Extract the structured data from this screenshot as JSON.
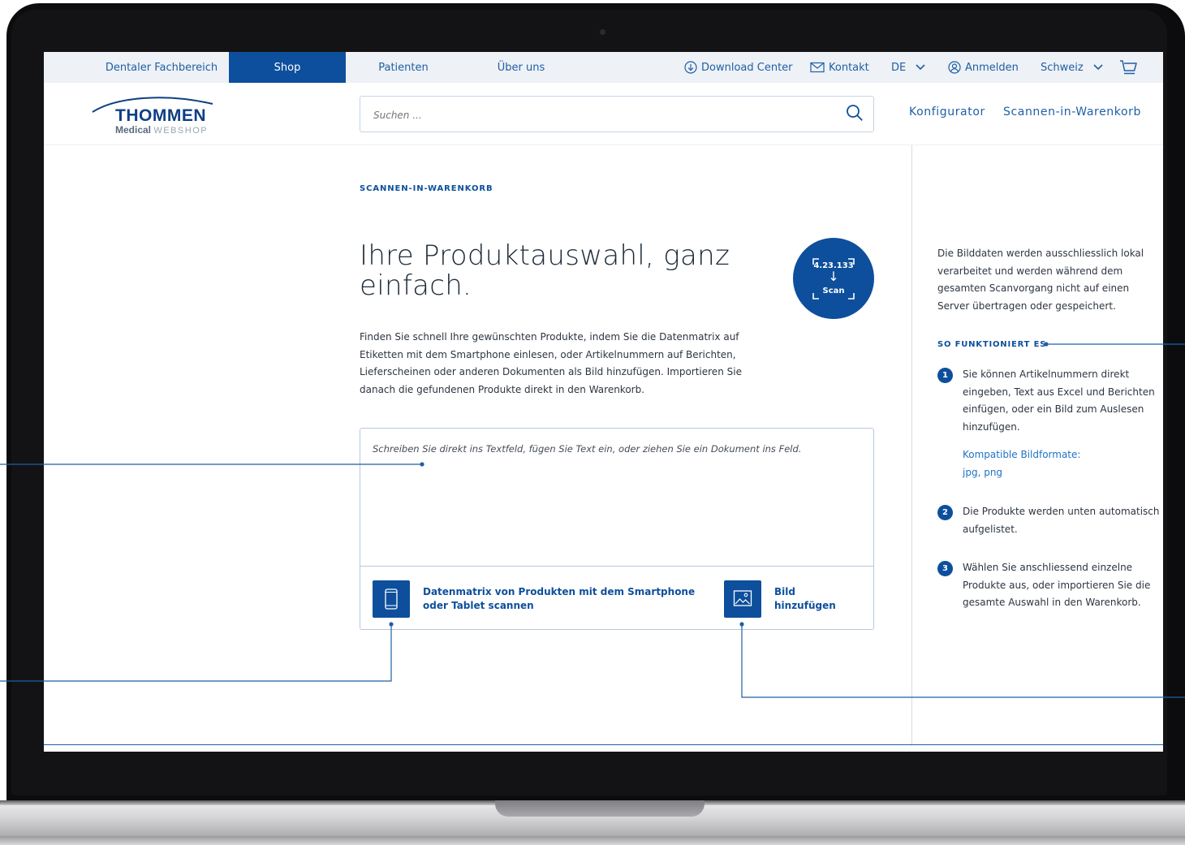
{
  "topnav": {
    "tabs": [
      {
        "label": "Dentaler Fachbereich",
        "active": false
      },
      {
        "label": "Shop",
        "active": true
      },
      {
        "label": "Patienten",
        "active": false
      },
      {
        "label": "Über uns",
        "active": false
      }
    ],
    "utility": {
      "download": "Download Center",
      "contact": "Kontakt",
      "language": "DE",
      "login": "Anmelden",
      "country": "Schweiz"
    }
  },
  "header": {
    "logo": {
      "main": "THOMMEN",
      "sub": "Medical",
      "sub_light": "WEBSHOP"
    },
    "search_placeholder": "Suchen ...",
    "nav": {
      "configurator": "Konfigurator",
      "scan_to_cart": "Scannen-in-Warenkorb"
    }
  },
  "main": {
    "eyebrow": "SCANNEN-IN-WARENKORB",
    "title": "Ihre Produktauswahl, ganz einfach.",
    "badge": {
      "number": "4.23.133",
      "arrow": "↓",
      "label": "Scan"
    },
    "intro": "Finden Sie schnell Ihre gewünschten Produkte, indem Sie die Datenmatrix auf Etiketten mit dem Smartphone einlesen, oder Artikelnummern auf Berichten, Lieferscheinen oder anderen Dokumenten als Bild hinzufügen. Importieren Sie danach die gefundenen Produkte direkt in den Warenkorb.",
    "input_placeholder": "Schreiben Sie direkt ins Textfeld, fügen Sie Text ein, oder ziehen Sie ein Dokument ins Feld.",
    "actions": {
      "scan": "Datenmatrix von Produkten mit dem Smartphone oder Tablet scannen",
      "image": "Bild hinzufügen"
    }
  },
  "sidebar": {
    "intro": "Die Bilddaten werden ausschliesslich lokal verarbeitet und werden während dem gesamten Scanvorgang nicht auf einen Server übertragen oder gespeichert.",
    "heading": "SO FUNKTIONIERT ES",
    "steps": [
      {
        "num": "1",
        "text": "Sie können Artikelnummern direkt eingeben, Text aus Excel und Berichten einfügen, oder ein Bild zum Auslesen hinzufügen."
      },
      {
        "num": "2",
        "text": "Die Produkte werden unten automatisch aufgelistet."
      },
      {
        "num": "3",
        "text": "Wählen Sie anschliessend einzelne Produkte aus, oder importieren Sie die gesamte Auswahl in den Warenkorb."
      }
    ],
    "formats_label": "Kompatible Bildformate:",
    "formats_value": "jpg, png"
  },
  "colors": {
    "brand_blue": "#0d4f9c",
    "link_blue": "#1f5fa6",
    "topbar_bg": "#eef1f5",
    "text": "#2d3540"
  },
  "icons": [
    "download-icon",
    "mail-icon",
    "chevron-down-icon",
    "user-icon",
    "cart-icon",
    "search-icon",
    "smartphone-icon",
    "image-icon"
  ]
}
